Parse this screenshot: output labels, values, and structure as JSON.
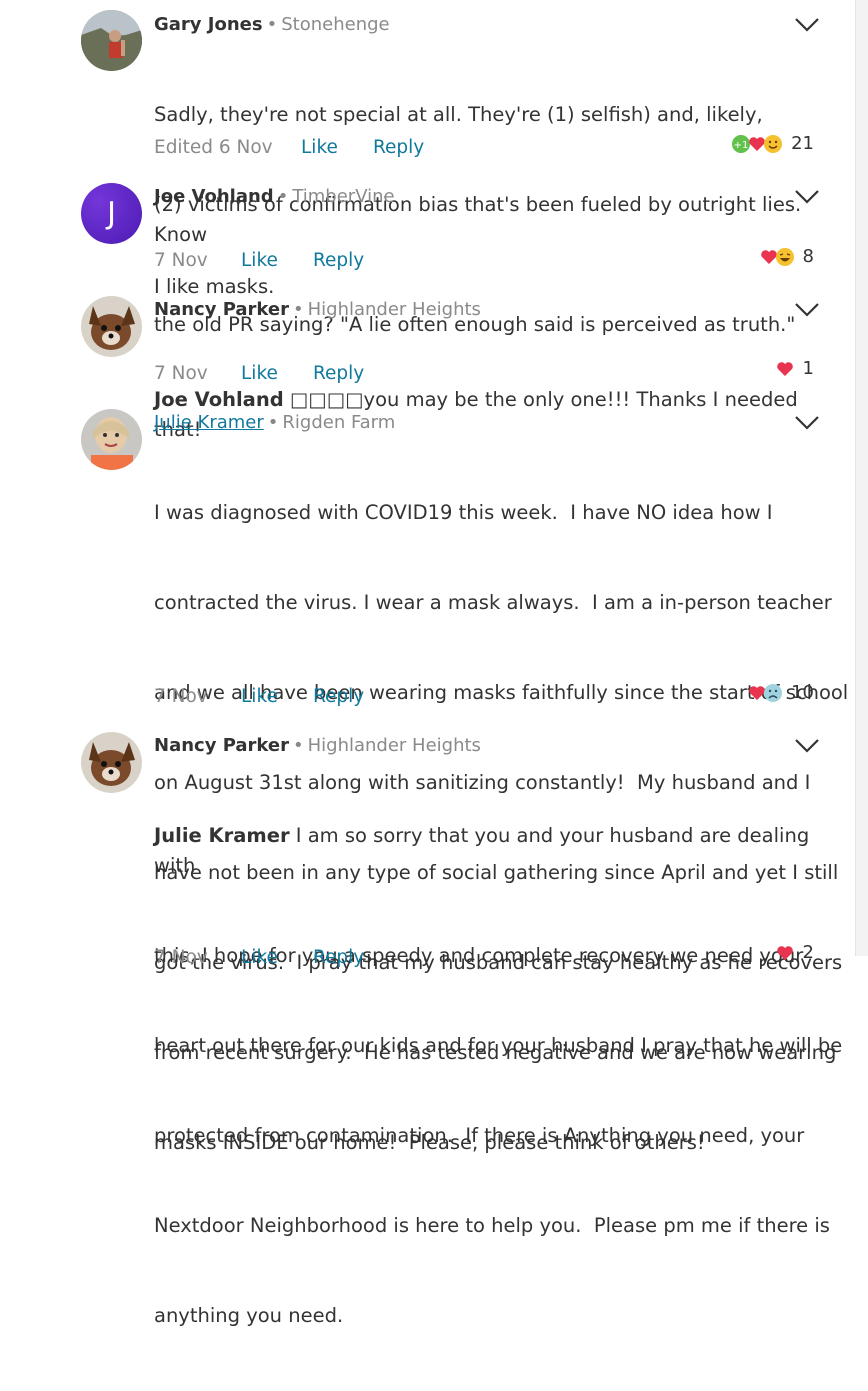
{
  "comments": [
    {
      "author": "Gary Jones",
      "neighborhood": "Stonehenge",
      "lines": [
        "Sadly, they're not special at all. They're (1) selfish) and, likely,",
        "(2) victims of confirmation bias that's been fueled by outright lies. Know",
        "the old PR saying? \"A lie often enough said is perceived as truth.\""
      ],
      "date": "Edited 6 Nov",
      "like_label": "Like",
      "reply_label": "Reply",
      "reactions": [
        "plus-one-icon",
        "heart-icon",
        "smile-icon"
      ],
      "reaction_count": "21"
    },
    {
      "author": "Joe Vohland",
      "neighborhood": "TimberVine",
      "avatar_letter": "J",
      "lines": [
        "I like masks."
      ],
      "date": "7 Nov",
      "like_label": "Like",
      "reply_label": "Reply",
      "reactions": [
        "heart-icon",
        "laugh-icon"
      ],
      "reaction_count": "8"
    },
    {
      "author": "Nancy Parker",
      "neighborhood": "Highlander Heights",
      "mention": "Joe Vohland",
      "lines": [
        " □□□□you may be the only one!!! Thanks I needed that!"
      ],
      "date": "7 Nov",
      "like_label": "Like",
      "reply_label": "Reply",
      "reactions": [
        "heart-icon"
      ],
      "reaction_count": "1"
    },
    {
      "author": "Julie Kramer",
      "neighborhood": "Rigden Farm",
      "lines": [
        "I was diagnosed with COVID19 this week.  I have NO idea how I",
        "contracted the virus. I wear a mask always.  I am a in-person teacher",
        "and we all have been wearing masks faithfully since the start of school",
        "on August 31st along with sanitizing constantly!  My husband and I",
        "have not been in any type of social gathering since April and yet I still",
        "got the virus.  I pray that my husband can stay healthy as he recovers",
        "from recent surgery.  He has tested negative and we are now wearing",
        "masks INSIDE our home!  Please, please think of others!"
      ],
      "date": "7 Nov",
      "like_label": "Like",
      "reply_label": "Reply",
      "reactions": [
        "heart-icon",
        "sad-icon"
      ],
      "reaction_count": "10"
    },
    {
      "author": "Nancy Parker",
      "neighborhood": "Highlander Heights",
      "mention": "Julie Kramer",
      "lines": [
        " I am so sorry that you and your husband are dealing with",
        "this, I hope for you a speedy and complete recovery we need your",
        "heart out there for our kids and for your husband I pray that he will be",
        "protected from contamination.  If there is Anything you need, your",
        "Nextdoor Neighborhood is here to help you.  Please pm me if there is",
        "anything you need."
      ],
      "date": "7 Nov",
      "like_label": "Like",
      "reply_label": "Reply",
      "reactions": [
        "heart-icon"
      ],
      "reaction_count": "2"
    }
  ],
  "separator": "•",
  "colors": {
    "link": "#11799b",
    "muted": "#8a8a8a",
    "text": "#333333",
    "heart": "#e8344e"
  }
}
